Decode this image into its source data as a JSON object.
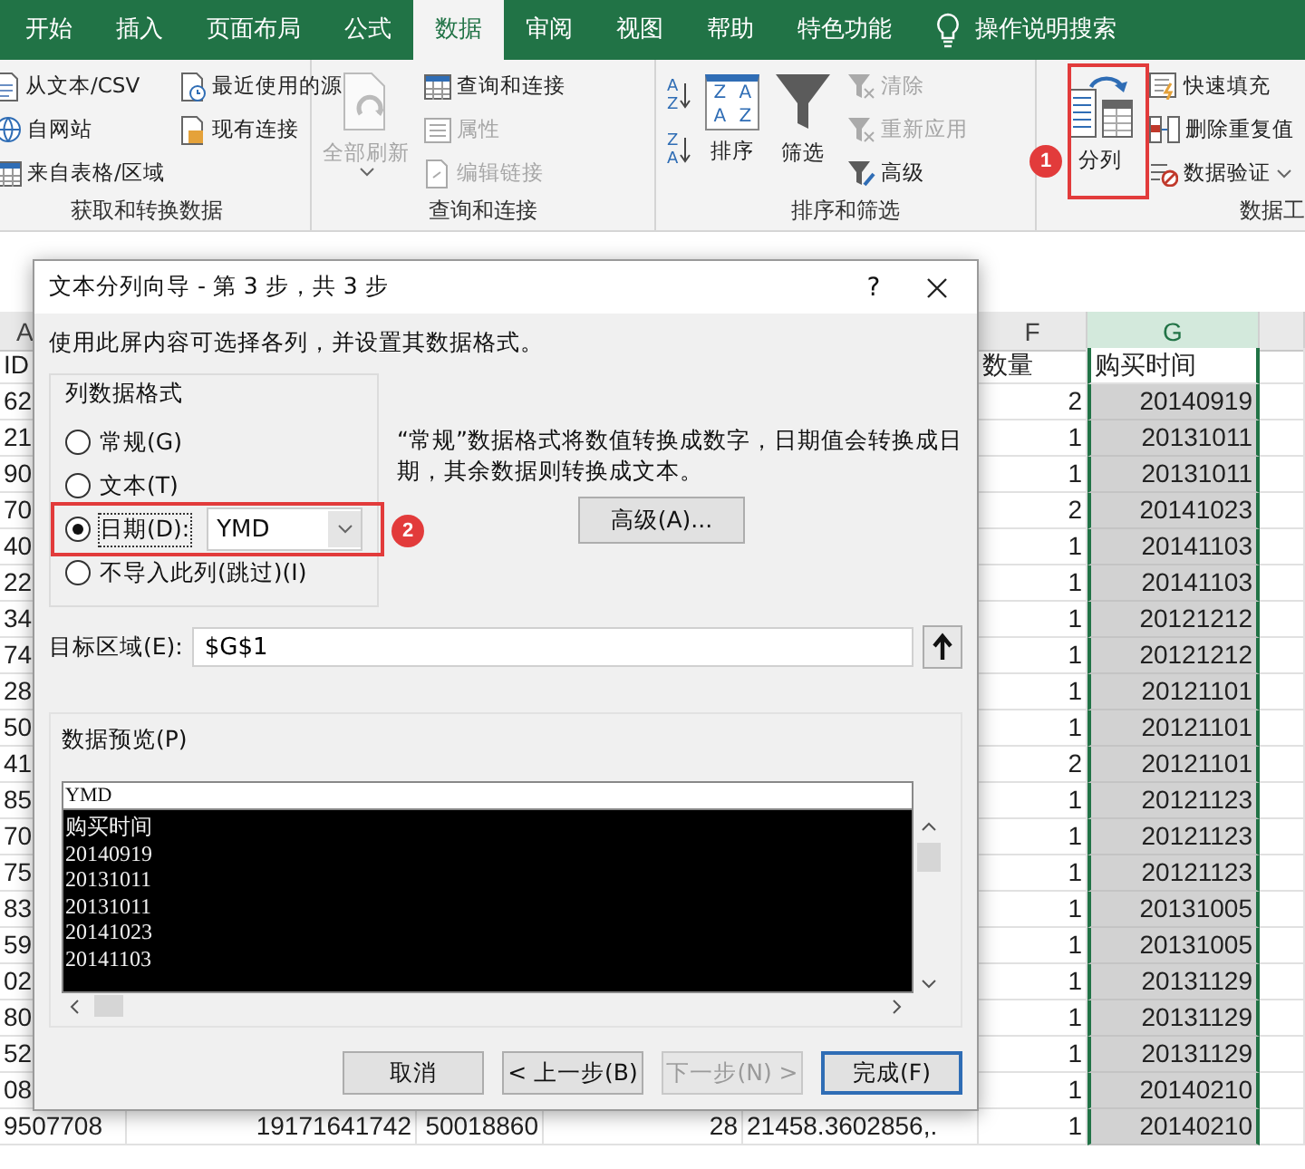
{
  "ribbon": {
    "tabs": [
      {
        "label": "开始",
        "selected": false
      },
      {
        "label": "插入",
        "selected": false
      },
      {
        "label": "页面布局",
        "selected": false
      },
      {
        "label": "公式",
        "selected": false
      },
      {
        "label": "数据",
        "selected": true
      },
      {
        "label": "审阅",
        "selected": false
      },
      {
        "label": "视图",
        "selected": false
      },
      {
        "label": "帮助",
        "selected": false
      },
      {
        "label": "特色功能",
        "selected": false
      }
    ],
    "search": "操作说明搜索",
    "groups": [
      {
        "label": "获取和转换数据",
        "columns": [
          {
            "kind": "stack",
            "items": [
              {
                "label": "从文本/CSV",
                "disabled": false
              },
              {
                "label": "自网站",
                "disabled": false
              },
              {
                "label": "来自表格/区域",
                "disabled": false
              }
            ]
          },
          {
            "kind": "stack",
            "items": [
              {
                "label": "最近使用的源",
                "disabled": false
              },
              {
                "label": "现有连接",
                "disabled": false
              }
            ]
          }
        ]
      },
      {
        "label": "查询和连接",
        "columns": [
          {
            "kind": "big",
            "label": "全部刷新",
            "disabled": true,
            "caret": true
          },
          {
            "kind": "stack",
            "items": [
              {
                "label": "查询和连接",
                "disabled": false
              },
              {
                "label": "属性",
                "disabled": true
              },
              {
                "label": "编辑链接",
                "disabled": true
              }
            ]
          }
        ]
      },
      {
        "label": "排序和筛选",
        "columns": [
          {
            "kind": "sort",
            "items": [
              {
                "top": "A",
                "bottom": "Z"
              },
              {
                "top": "Z",
                "bottom": "A"
              }
            ]
          },
          {
            "kind": "big",
            "label": "排序",
            "disabled": false,
            "icon_text": [
              "Z",
              "A",
              "A",
              "Z"
            ]
          },
          {
            "kind": "big",
            "label": "筛选",
            "disabled": false
          },
          {
            "kind": "stack",
            "items": [
              {
                "label": "清除",
                "disabled": true
              },
              {
                "label": "重新应用",
                "disabled": true
              },
              {
                "label": "高级",
                "disabled": false
              }
            ]
          }
        ]
      },
      {
        "label": "数据工",
        "columns": [
          {
            "kind": "big",
            "label": "分列",
            "disabled": false
          },
          {
            "kind": "stack",
            "items": [
              {
                "label": "快速填充",
                "disabled": false
              },
              {
                "label": "删除重复值",
                "disabled": false
              },
              {
                "label": "数据验证",
                "disabled": false,
                "caret": true
              }
            ]
          }
        ]
      }
    ]
  },
  "sheet": {
    "columns": [
      {
        "label": "A",
        "selected": false
      },
      {
        "label": "F",
        "selected": false
      },
      {
        "label": "G",
        "selected": true
      }
    ],
    "rows": [
      {
        "kind": "header",
        "a": "ID",
        "f": "数量",
        "g": "购买时间"
      },
      {
        "kind": "data",
        "a": "62",
        "f": "2",
        "g": "20140919"
      },
      {
        "kind": "data",
        "a": "21",
        "f": "1",
        "g": "20131011"
      },
      {
        "kind": "data",
        "a": "90",
        "f": "1",
        "g": "20131011"
      },
      {
        "kind": "data",
        "a": "70",
        "f": "2",
        "g": "20141023"
      },
      {
        "kind": "data",
        "a": "40",
        "f": "1",
        "g": "20141103"
      },
      {
        "kind": "data",
        "a": "22",
        "f": "1",
        "g": "20141103"
      },
      {
        "kind": "data",
        "a": "34",
        "f": "1",
        "g": "20121212"
      },
      {
        "kind": "data",
        "a": "74",
        "f": "1",
        "g": "20121212"
      },
      {
        "kind": "data",
        "a": "28",
        "f": "1",
        "g": "20121101"
      },
      {
        "kind": "data",
        "a": "50",
        "f": "1",
        "g": "20121101"
      },
      {
        "kind": "data",
        "a": "41",
        "f": "2",
        "g": "20121101"
      },
      {
        "kind": "data",
        "a": "85",
        "f": "1",
        "g": "20121123"
      },
      {
        "kind": "data",
        "a": "70",
        "f": "1",
        "g": "20121123"
      },
      {
        "kind": "data",
        "a": "75",
        "f": "1",
        "g": "20121123"
      },
      {
        "kind": "data",
        "a": "83",
        "f": "1",
        "g": "20131005"
      },
      {
        "kind": "data",
        "a": "59",
        "f": "1",
        "g": "20131005"
      },
      {
        "kind": "data",
        "a": "02",
        "f": "1",
        "g": "20131129"
      },
      {
        "kind": "data",
        "a": "80",
        "f": "1",
        "g": "20131129"
      },
      {
        "kind": "data",
        "a": "52",
        "f": "1",
        "g": "20131129"
      },
      {
        "kind": "data",
        "a": "08",
        "f": "1",
        "g": "20140210"
      },
      {
        "kind": "data",
        "a": "9507708",
        "b": "19171641742",
        "c": "50018860",
        "d": "28",
        "e": "21458.3602856,.",
        "f": "1",
        "g": "20140210"
      }
    ]
  },
  "dialog": {
    "title": "文本分列向导 - 第 3 步，共 3 步",
    "help": "?",
    "intro": "使用此屏内容可选择各列，并设置其数据格式。",
    "format_group": {
      "label": "列数据格式",
      "options": [
        {
          "label": "常规(G)",
          "selected": false
        },
        {
          "label": "文本(T)",
          "selected": false
        },
        {
          "label": "日期(D):",
          "selected": true,
          "dropdown": "YMD"
        },
        {
          "label": "不导入此列(跳过)(I)",
          "selected": false
        }
      ]
    },
    "description": "“常规”数据格式将数值转换成数字，日期值会转换成日期，其余数据则转换成文本。",
    "advanced_button": "高级(A)...",
    "destination": {
      "label": "目标区域(E):",
      "value": "$G$1"
    },
    "preview": {
      "label": "数据预览(P)",
      "columns": [
        {
          "format": "YMD",
          "selected": true,
          "lines": [
            "购买时间",
            "20140919",
            "20131011",
            "20131011",
            "20141023",
            "20141103"
          ]
        }
      ]
    },
    "buttons": [
      {
        "label": "取消",
        "disabled": false,
        "default": false
      },
      {
        "label": "< 上一步(B)",
        "disabled": false,
        "default": false
      },
      {
        "label": "下一步(N) >",
        "disabled": true,
        "default": false
      },
      {
        "label": "完成(F)",
        "disabled": false,
        "default": true
      }
    ]
  },
  "annotations": [
    {
      "label": "1"
    },
    {
      "label": "2"
    }
  ]
}
